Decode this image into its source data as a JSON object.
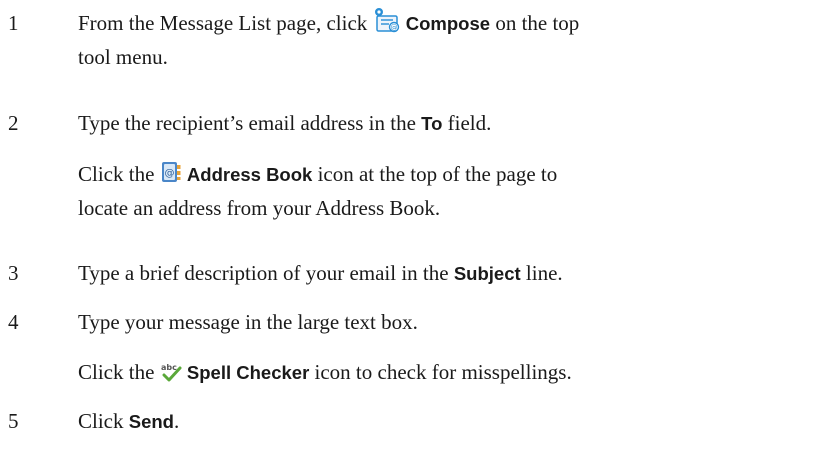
{
  "steps": [
    {
      "number": "1",
      "line1_pre": "From the Message List page, click ",
      "line1_bold": "Compose",
      "line1_post": " on the top",
      "line2": "tool menu.",
      "icon": "compose-icon"
    },
    {
      "number": "2",
      "pre": "Type the recipient’s email address in the ",
      "bold": "To",
      "post": " field."
    },
    {
      "note_pre": "Click the ",
      "note_bold": "Address Book",
      "note_post": " icon at the top of the page to",
      "note_line2": "locate an address from your Address Book.",
      "icon": "address-book-icon"
    },
    {
      "number": "3",
      "pre": "Type a brief description of your email in the ",
      "bold": "Subject",
      "post": " line."
    },
    {
      "number": "4",
      "text": "Type your message in the large text box."
    },
    {
      "note_pre": "Click the ",
      "note_bold": "Spell Checker",
      "note_post": " icon to check for misspellings.",
      "icon": "spell-checker-icon"
    },
    {
      "number": "5",
      "pre": "Click ",
      "bold": "Send",
      "post": "."
    }
  ],
  "colors": {
    "text": "#1a1a1a",
    "compose_icon_blue": "#2a8fd6",
    "address_book_blue": "#4a86c8",
    "address_book_orange": "#e8a33a",
    "spell_green": "#5aa83a"
  }
}
